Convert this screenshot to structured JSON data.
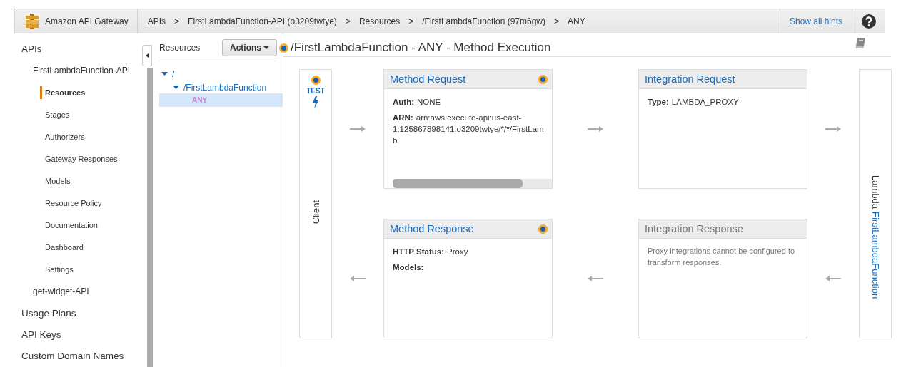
{
  "header": {
    "logo_text": "Amazon API Gateway",
    "separator": ">",
    "breadcrumbs": [
      "APIs",
      "FirstLambdaFunction-API (o3209twtye)",
      "Resources",
      "/FirstLambdaFunction (97m6gw)",
      "ANY"
    ],
    "hints_link": "Show all hints"
  },
  "sidebar": {
    "items": [
      {
        "label": "APIs",
        "selected": false,
        "children": [
          {
            "label": "FirstLambdaFunction-API",
            "selected": false,
            "children": [
              {
                "label": "Resources",
                "selected": true
              },
              {
                "label": "Stages",
                "selected": false
              },
              {
                "label": "Authorizers",
                "selected": false
              },
              {
                "label": "Gateway Responses",
                "selected": false
              },
              {
                "label": "Models",
                "selected": false
              },
              {
                "label": "Resource Policy",
                "selected": false
              },
              {
                "label": "Documentation",
                "selected": false
              },
              {
                "label": "Dashboard",
                "selected": false
              },
              {
                "label": "Settings",
                "selected": false
              }
            ]
          },
          {
            "label": "get-widget-API",
            "selected": false
          }
        ]
      },
      {
        "label": "Usage Plans",
        "selected": false
      },
      {
        "label": "API Keys",
        "selected": false
      },
      {
        "label": "Custom Domain Names",
        "selected": false
      }
    ]
  },
  "resources_panel": {
    "title": "Resources",
    "actions_button": "Actions",
    "tree": [
      {
        "label": "/",
        "kind": "path",
        "expanded": true,
        "selected": false,
        "children": [
          {
            "label": "/FirstLambdaFunction",
            "kind": "path",
            "expanded": true,
            "selected": false,
            "children": [
              {
                "label": "ANY",
                "kind": "method",
                "selected": true
              }
            ]
          }
        ]
      }
    ]
  },
  "page_title": "/FirstLambdaFunction - ANY - Method Execution",
  "client": {
    "badge": "TEST",
    "label": "Client"
  },
  "cards": [
    {
      "title": "Method Request",
      "disabled": false,
      "hint": true,
      "scrollbar": true,
      "fields": [
        {
          "label": "Auth:",
          "value": "NONE"
        },
        {
          "label": "ARN:",
          "value": "arn:aws:execute-api:us-east-1:125867898141:o3209twtye/*/*/FirstLamb"
        }
      ]
    },
    {
      "title": "Integration Request",
      "disabled": false,
      "hint": false,
      "scrollbar": false,
      "fields": [
        {
          "label": "Type:",
          "value": "LAMBDA_PROXY"
        }
      ]
    },
    {
      "title": "Method Response",
      "disabled": false,
      "hint": true,
      "scrollbar": false,
      "fields": [
        {
          "label": "HTTP Status:",
          "value": "Proxy"
        },
        {
          "label": "Models:"
        }
      ]
    },
    {
      "title": "Integration Response",
      "disabled": true,
      "hint": false,
      "scrollbar": false,
      "note": "Proxy integrations cannot be configured to transform responses."
    }
  ],
  "lambda": {
    "prefix": "Lambda",
    "link": "FirstLambdaFunction"
  }
}
